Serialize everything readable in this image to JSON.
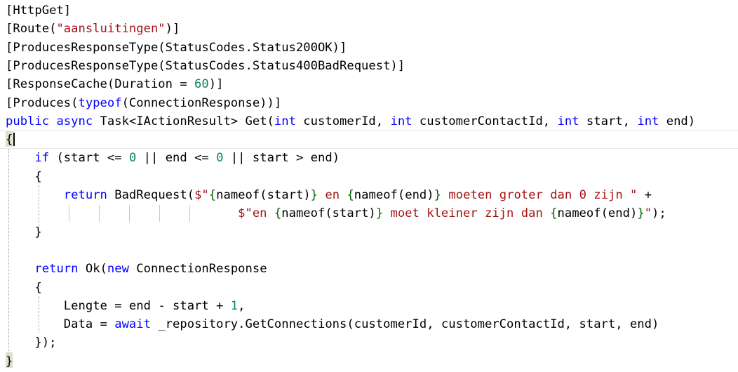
{
  "editor": {
    "language": "csharp",
    "colors": {
      "keyword": "#0000ff",
      "string": "#a31515",
      "number": "#098658",
      "interpolation_brace": "#006400",
      "text": "#000000",
      "brace_match_highlight": "#dbe0cc"
    },
    "lines": [
      {
        "indent": "",
        "tokens": [
          {
            "t": "plain",
            "v": "[HttpGet]"
          }
        ]
      },
      {
        "indent": "",
        "tokens": [
          {
            "t": "plain",
            "v": "[Route("
          },
          {
            "t": "str",
            "v": "\"aansluitingen\""
          },
          {
            "t": "plain",
            "v": ")]"
          }
        ]
      },
      {
        "indent": "",
        "tokens": [
          {
            "t": "plain",
            "v": "[ProducesResponseType(StatusCodes.Status200OK)]"
          }
        ]
      },
      {
        "indent": "",
        "tokens": [
          {
            "t": "plain",
            "v": "[ProducesResponseType(StatusCodes.Status400BadRequest)]"
          }
        ]
      },
      {
        "indent": "",
        "tokens": [
          {
            "t": "plain",
            "v": "[ResponseCache(Duration = "
          },
          {
            "t": "num",
            "v": "60"
          },
          {
            "t": "plain",
            "v": ")]"
          }
        ]
      },
      {
        "indent": "",
        "tokens": [
          {
            "t": "plain",
            "v": "[Produces("
          },
          {
            "t": "kw",
            "v": "typeof"
          },
          {
            "t": "plain",
            "v": "(ConnectionResponse))]"
          }
        ]
      },
      {
        "indent": "",
        "tokens": [
          {
            "t": "kw",
            "v": "public"
          },
          {
            "t": "plain",
            "v": " "
          },
          {
            "t": "kw",
            "v": "async"
          },
          {
            "t": "plain",
            "v": " Task<IActionResult> Get("
          },
          {
            "t": "kw",
            "v": "int"
          },
          {
            "t": "plain",
            "v": " customerId, "
          },
          {
            "t": "kw",
            "v": "int"
          },
          {
            "t": "plain",
            "v": " customerContactId, "
          },
          {
            "t": "kw",
            "v": "int"
          },
          {
            "t": "plain",
            "v": " start, "
          },
          {
            "t": "kw",
            "v": "int"
          },
          {
            "t": "plain",
            "v": " end)"
          }
        ]
      },
      {
        "indent": "",
        "tokens": [
          {
            "t": "plain",
            "v": "{"
          }
        ]
      },
      {
        "indent": "    ",
        "tokens": [
          {
            "t": "kw",
            "v": "if"
          },
          {
            "t": "plain",
            "v": " (start <= "
          },
          {
            "t": "num",
            "v": "0"
          },
          {
            "t": "plain",
            "v": " || end <= "
          },
          {
            "t": "num",
            "v": "0"
          },
          {
            "t": "plain",
            "v": " || start > end)"
          }
        ]
      },
      {
        "indent": "    ",
        "tokens": [
          {
            "t": "plain",
            "v": "{"
          }
        ]
      },
      {
        "indent": "        ",
        "tokens": [
          {
            "t": "kw",
            "v": "return"
          },
          {
            "t": "plain",
            "v": " BadRequest("
          },
          {
            "t": "str",
            "v": "$\""
          },
          {
            "t": "interp",
            "v": "{"
          },
          {
            "t": "plain",
            "v": "nameof(start)"
          },
          {
            "t": "interp",
            "v": "}"
          },
          {
            "t": "str",
            "v": " en "
          },
          {
            "t": "interp",
            "v": "{"
          },
          {
            "t": "plain",
            "v": "nameof(end)"
          },
          {
            "t": "interp",
            "v": "}"
          },
          {
            "t": "str",
            "v": " moeten groter dan 0 zijn \""
          },
          {
            "t": "plain",
            "v": " +"
          }
        ]
      },
      {
        "indent": "                                ",
        "tokens": [
          {
            "t": "str",
            "v": "$\"en "
          },
          {
            "t": "interp",
            "v": "{"
          },
          {
            "t": "plain",
            "v": "nameof(start)"
          },
          {
            "t": "interp",
            "v": "}"
          },
          {
            "t": "str",
            "v": " moet kleiner zijn dan "
          },
          {
            "t": "interp",
            "v": "{"
          },
          {
            "t": "plain",
            "v": "nameof(end)"
          },
          {
            "t": "interp",
            "v": "}"
          },
          {
            "t": "str",
            "v": "\""
          },
          {
            "t": "plain",
            "v": ");"
          }
        ]
      },
      {
        "indent": "    ",
        "tokens": [
          {
            "t": "plain",
            "v": "}"
          }
        ]
      },
      {
        "indent": "",
        "tokens": []
      },
      {
        "indent": "    ",
        "tokens": [
          {
            "t": "kw",
            "v": "return"
          },
          {
            "t": "plain",
            "v": " Ok("
          },
          {
            "t": "kw",
            "v": "new"
          },
          {
            "t": "plain",
            "v": " ConnectionResponse"
          }
        ]
      },
      {
        "indent": "    ",
        "tokens": [
          {
            "t": "plain",
            "v": "{"
          }
        ]
      },
      {
        "indent": "        ",
        "tokens": [
          {
            "t": "plain",
            "v": "Lengte = end - start + "
          },
          {
            "t": "num",
            "v": "1"
          },
          {
            "t": "plain",
            "v": ","
          }
        ]
      },
      {
        "indent": "        ",
        "tokens": [
          {
            "t": "plain",
            "v": "Data = "
          },
          {
            "t": "kw",
            "v": "await"
          },
          {
            "t": "plain",
            "v": " _repository.GetConnections(customerId, customerContactId, start, end)"
          }
        ]
      },
      {
        "indent": "    ",
        "tokens": [
          {
            "t": "plain",
            "v": "});"
          }
        ]
      },
      {
        "indent": "",
        "tokens": [
          {
            "t": "plain",
            "v": "}"
          }
        ]
      }
    ]
  }
}
